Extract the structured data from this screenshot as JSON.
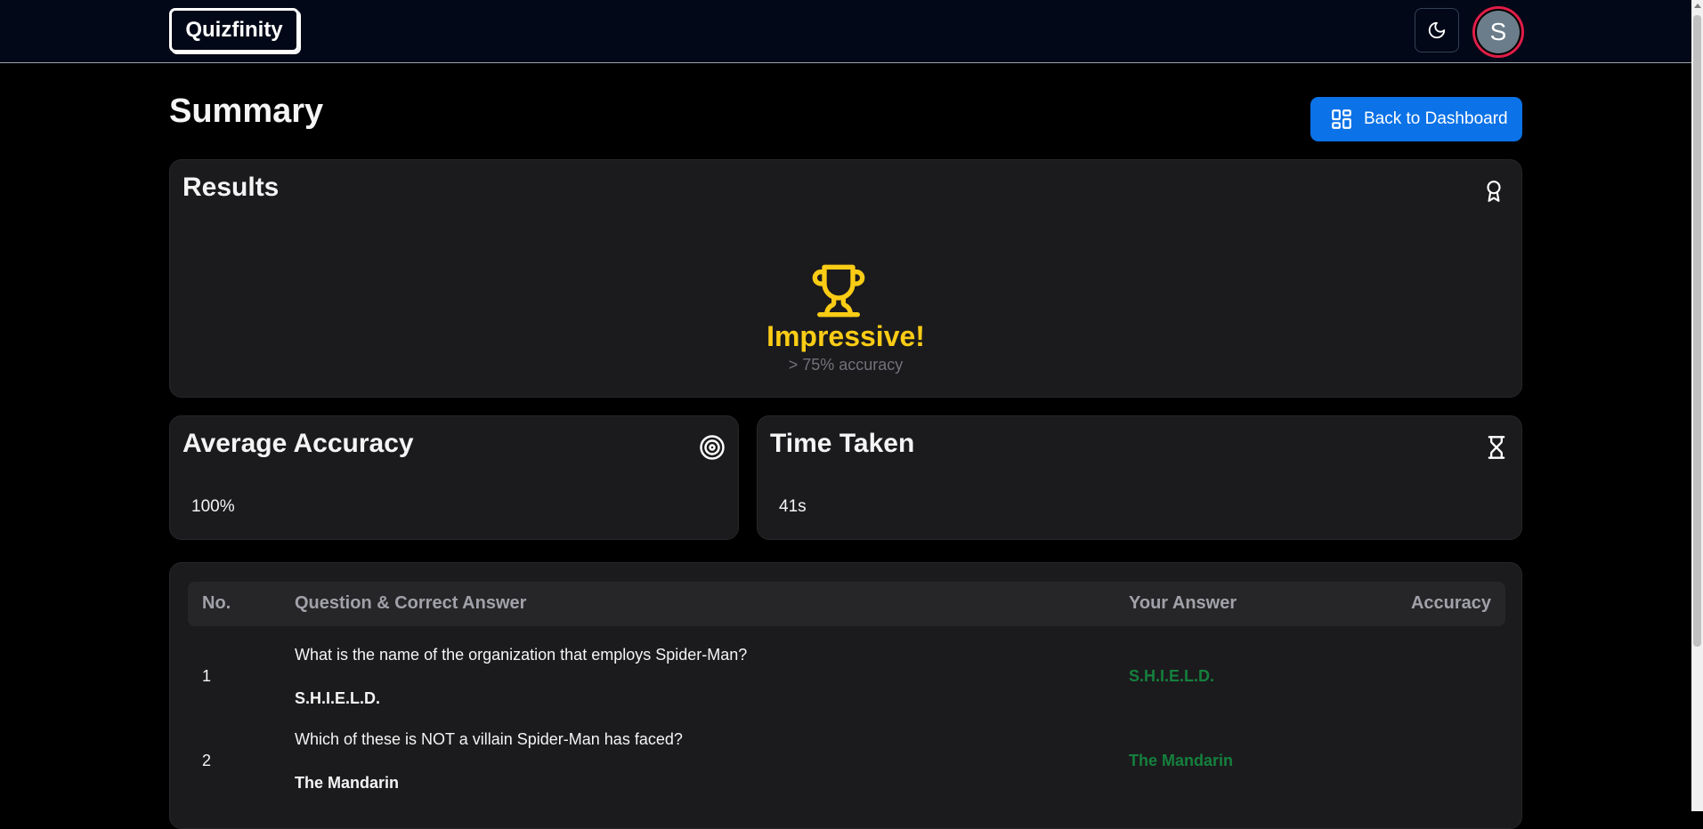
{
  "header": {
    "logo": "Quizfinity",
    "avatar_initial": "S"
  },
  "page": {
    "title": "Summary",
    "back_button": "Back to Dashboard"
  },
  "results": {
    "title": "Results",
    "verdict": "Impressive!",
    "note": "> 75% accuracy"
  },
  "average_accuracy": {
    "title": "Average Accuracy",
    "value": "100%"
  },
  "time_taken": {
    "title": "Time Taken",
    "value": "41s"
  },
  "table": {
    "headers": {
      "no": "No.",
      "question": "Question & Correct Answer",
      "your_answer": "Your Answer",
      "accuracy": "Accuracy"
    },
    "rows": [
      {
        "no": "1",
        "question": "What is the name of the organization that employs Spider-Man?",
        "correct": "S.H.I.E.L.D.",
        "your_answer": "S.H.I.E.L.D."
      },
      {
        "no": "2",
        "question": "Which of these is NOT a villain Spider-Man has faced?",
        "correct": "The Mandarin",
        "your_answer": "The Mandarin"
      }
    ]
  },
  "colors": {
    "accent": "#0b72e7",
    "trophy": "#facc15",
    "correct": "#15803d",
    "avatar_ring": "#e11d48"
  }
}
